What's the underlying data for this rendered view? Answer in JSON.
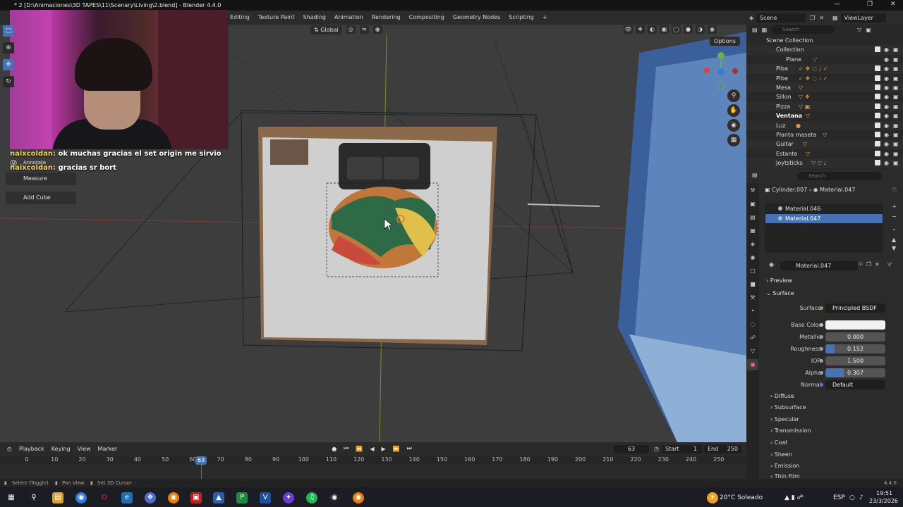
{
  "window": {
    "title": "* 2 [D:\\Animaciones\\3D TAPES\\11\\Scenary\\Living\\2.blend] - Blender 4.4.0"
  },
  "workspace_tabs": [
    "Editing",
    "Texture Paint",
    "Shading",
    "Animation",
    "Rendering",
    "Compositing",
    "Geometry Nodes",
    "Scripting",
    "+"
  ],
  "topbar_right": {
    "scene": "Scene",
    "view_layer": "ViewLayer"
  },
  "viewport": {
    "orientation": "Global",
    "options_label": "Options",
    "tool_list": [
      "Annotate",
      "Measure",
      "Add Cube"
    ]
  },
  "chat": [
    {
      "user": "naixcoldan:",
      "message": "ok muchas gracias el set origin me sirvio"
    },
    {
      "user": "naixcoldan:",
      "message": "gracias sr bort"
    }
  ],
  "outliner": {
    "search_placeholder": "Search",
    "rows": [
      {
        "label": "Scene Collection",
        "indent": 0
      },
      {
        "label": "Collection",
        "indent": 1
      },
      {
        "label": "Plane",
        "indent": 2
      },
      {
        "label": "Piba",
        "indent": 1
      },
      {
        "label": "Pibe",
        "indent": 1
      },
      {
        "label": "Mesa",
        "indent": 1
      },
      {
        "label": "Sillon",
        "indent": 1
      },
      {
        "label": "Pizza",
        "indent": 1
      },
      {
        "label": "Ventana",
        "indent": 1
      },
      {
        "label": "Luz",
        "indent": 1
      },
      {
        "label": "Planta maseta",
        "indent": 1
      },
      {
        "label": "Guitar",
        "indent": 1
      },
      {
        "label": "Estante",
        "indent": 1
      },
      {
        "label": "Joytsticks",
        "indent": 1
      }
    ]
  },
  "properties": {
    "search_placeholder": "Search",
    "breadcrumb_object": "Cylinder.007",
    "breadcrumb_material": "Material.047",
    "slots": [
      "Material.046",
      "Material.047"
    ],
    "material_name": "Material.047",
    "preview_label": "Preview",
    "surface_label": "Surface",
    "fields": {
      "surface_label": "Surface",
      "surface_value": "Principled BSDF",
      "base_color_label": "Base Color",
      "metallic_label": "Metallic",
      "metallic_value": "0.000",
      "roughness_label": "Roughness",
      "roughness_value": "0.152",
      "ior_label": "IOR",
      "ior_value": "1.500",
      "alpha_label": "Alpha",
      "alpha_value": "0.307",
      "normal_label": "Normal",
      "normal_value": "Default"
    },
    "roughness_fraction": 0.152,
    "alpha_fraction": 0.307,
    "subpanels": [
      "Diffuse",
      "Subsurface",
      "Specular",
      "Transmission",
      "Coat",
      "Sheen",
      "Emission",
      "Thin Film"
    ]
  },
  "timeline": {
    "menus": [
      "Playback",
      "Keying",
      "View",
      "Marker"
    ],
    "current_frame": "63",
    "start_label": "Start",
    "start_value": "1",
    "end_label": "End",
    "end_value": "250",
    "ticks": [
      "0",
      "10",
      "20",
      "30",
      "40",
      "50",
      "60",
      "70",
      "80",
      "90",
      "100",
      "110",
      "120",
      "130",
      "140",
      "150",
      "160",
      "170",
      "180",
      "190",
      "200",
      "210",
      "220",
      "230",
      "240",
      "250"
    ]
  },
  "statusbar": {
    "select": "Select (Toggle)",
    "pan": "Pan View",
    "cursor": "Set 3D Cursor",
    "version": "4.4.0"
  },
  "taskbar": {
    "weather": "20°C  Soleado",
    "language": "ESP",
    "time": "19:51",
    "date": "23/3/2026"
  }
}
